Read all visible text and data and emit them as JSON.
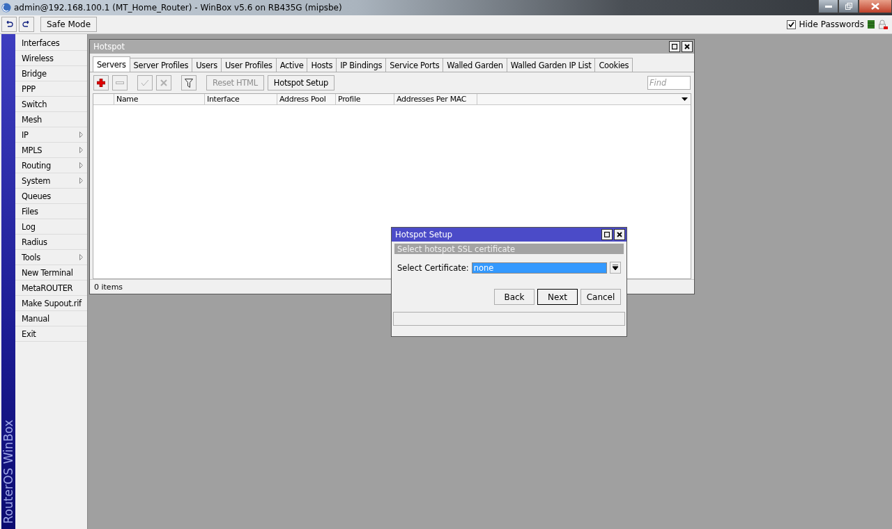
{
  "window": {
    "title": "admin@192.168.100.1 (MT_Home_Router) - WinBox v5.6 on RB435G (mipsbe)"
  },
  "toolbar": {
    "safe_mode": "Safe Mode",
    "hide_passwords": {
      "label": "Hide Passwords",
      "checked": true
    }
  },
  "sidebar": {
    "brand": "RouterOS WinBox",
    "items": [
      {
        "label": "Interfaces",
        "submenu": false
      },
      {
        "label": "Wireless",
        "submenu": false
      },
      {
        "label": "Bridge",
        "submenu": false
      },
      {
        "label": "PPP",
        "submenu": false
      },
      {
        "label": "Switch",
        "submenu": false
      },
      {
        "label": "Mesh",
        "submenu": false
      },
      {
        "label": "IP",
        "submenu": true
      },
      {
        "label": "MPLS",
        "submenu": true
      },
      {
        "label": "Routing",
        "submenu": true
      },
      {
        "label": "System",
        "submenu": true
      },
      {
        "label": "Queues",
        "submenu": false
      },
      {
        "label": "Files",
        "submenu": false
      },
      {
        "label": "Log",
        "submenu": false
      },
      {
        "label": "Radius",
        "submenu": false
      },
      {
        "label": "Tools",
        "submenu": true
      },
      {
        "label": "New Terminal",
        "submenu": false
      },
      {
        "label": "MetaROUTER",
        "submenu": false
      },
      {
        "label": "Make Supout.rif",
        "submenu": false
      },
      {
        "label": "Manual",
        "submenu": false
      },
      {
        "label": "Exit",
        "submenu": false
      }
    ]
  },
  "hotspot_window": {
    "title": "Hotspot",
    "tabs": [
      {
        "label": "Servers",
        "selected": true
      },
      {
        "label": "Server Profiles",
        "selected": false
      },
      {
        "label": "Users",
        "selected": false
      },
      {
        "label": "User Profiles",
        "selected": false
      },
      {
        "label": "Active",
        "selected": false
      },
      {
        "label": "Hosts",
        "selected": false
      },
      {
        "label": "IP Bindings",
        "selected": false
      },
      {
        "label": "Service Ports",
        "selected": false
      },
      {
        "label": "Walled Garden",
        "selected": false
      },
      {
        "label": "Walled Garden IP List",
        "selected": false
      },
      {
        "label": "Cookies",
        "selected": false
      }
    ],
    "buttons": [
      {
        "kind": "add",
        "disabled": false
      },
      {
        "kind": "remove",
        "disabled": true
      },
      {
        "kind": "enable",
        "disabled": true
      },
      {
        "kind": "disable",
        "disabled": true
      },
      {
        "kind": "filter",
        "disabled": false
      },
      {
        "kind": "text",
        "label": "Reset HTML",
        "disabled": true
      },
      {
        "kind": "text",
        "label": "Hotspot Setup",
        "disabled": false
      }
    ],
    "find": {
      "placeholder": "Find"
    },
    "table": {
      "columns": [
        "Name",
        "Interface",
        "Address Pool",
        "Profile",
        "Addresses Per MAC"
      ]
    },
    "status": "0 items"
  },
  "setup_dialog": {
    "title": "Hotspot Setup",
    "step": "Select hotspot SSL certificate",
    "field": {
      "label": "Select Certificate:",
      "value": "none"
    },
    "buttons": [
      {
        "label": "Back",
        "default": false
      },
      {
        "label": "Next",
        "default": true
      },
      {
        "label": "Cancel",
        "default": false
      }
    ]
  }
}
